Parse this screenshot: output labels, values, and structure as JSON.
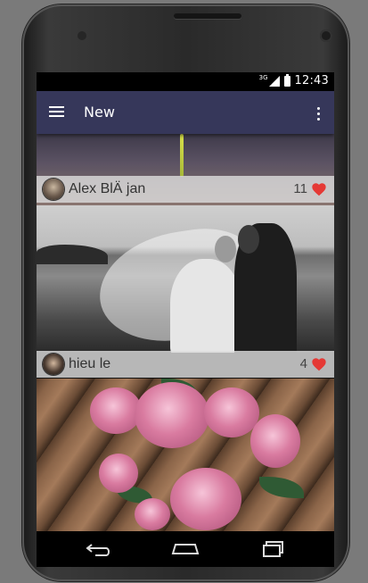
{
  "status_bar": {
    "network_type": "3G",
    "time": "12:43"
  },
  "toolbar": {
    "title": "New",
    "menu_icon": "hamburger-menu-icon",
    "overflow_icon": "more-vert-icon",
    "background_color": "#36375a"
  },
  "posts": [
    {
      "author": "Alex BlÄ jan",
      "likes": "11"
    },
    {
      "author": "hieu le",
      "likes": "4"
    }
  ],
  "colors": {
    "heart": "#e53935"
  },
  "navigation_bar": {
    "back_icon": "back-icon",
    "home_icon": "home-icon",
    "recents_icon": "recents-icon"
  }
}
